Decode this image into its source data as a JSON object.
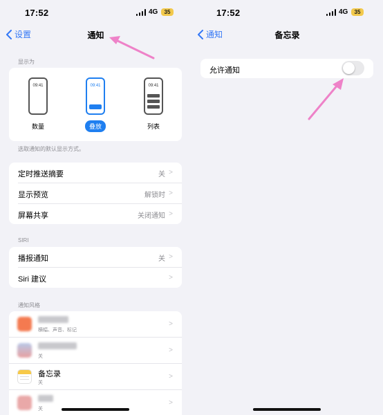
{
  "left": {
    "status": {
      "time": "17:52",
      "network": "4G",
      "battery": "35"
    },
    "nav": {
      "back_label": "设置",
      "title": "通知"
    },
    "display_as": {
      "section_label": "显示为",
      "options": [
        {
          "phone_time": "09:41",
          "label": "数量"
        },
        {
          "phone_time": "09:41",
          "label": "叠放"
        },
        {
          "phone_time": "09:41",
          "label": "列表"
        }
      ],
      "selected": "叠放",
      "footnote": "选取通知的默认显示方式。"
    },
    "general": [
      {
        "label": "定时推送摘要",
        "value": "关"
      },
      {
        "label": "显示预览",
        "value": "解锁时"
      },
      {
        "label": "屏幕共享",
        "value": "关闭通知"
      }
    ],
    "siri": {
      "section_label": "SIRI",
      "rows": [
        {
          "label": "播报通知",
          "value": "关"
        },
        {
          "label": "Siri 建议",
          "value": ""
        }
      ]
    },
    "app_style": {
      "section_label": "通知风格",
      "apps": [
        {
          "name": "",
          "sub": "横幅、声音、标记"
        },
        {
          "name": "",
          "sub": "关"
        },
        {
          "name": "备忘录",
          "sub": "关"
        },
        {
          "name": "",
          "sub": "关"
        }
      ]
    }
  },
  "right": {
    "status": {
      "time": "17:52",
      "network": "4G",
      "battery": "35"
    },
    "nav": {
      "back_label": "通知",
      "title": "备忘录"
    },
    "allow_label": "允许通知",
    "allow_enabled": false
  },
  "colors": {
    "accent": "#3478f6",
    "selected": "#1f7ff0",
    "arrow": "#ee82c8",
    "battery": "#f2c94c"
  }
}
